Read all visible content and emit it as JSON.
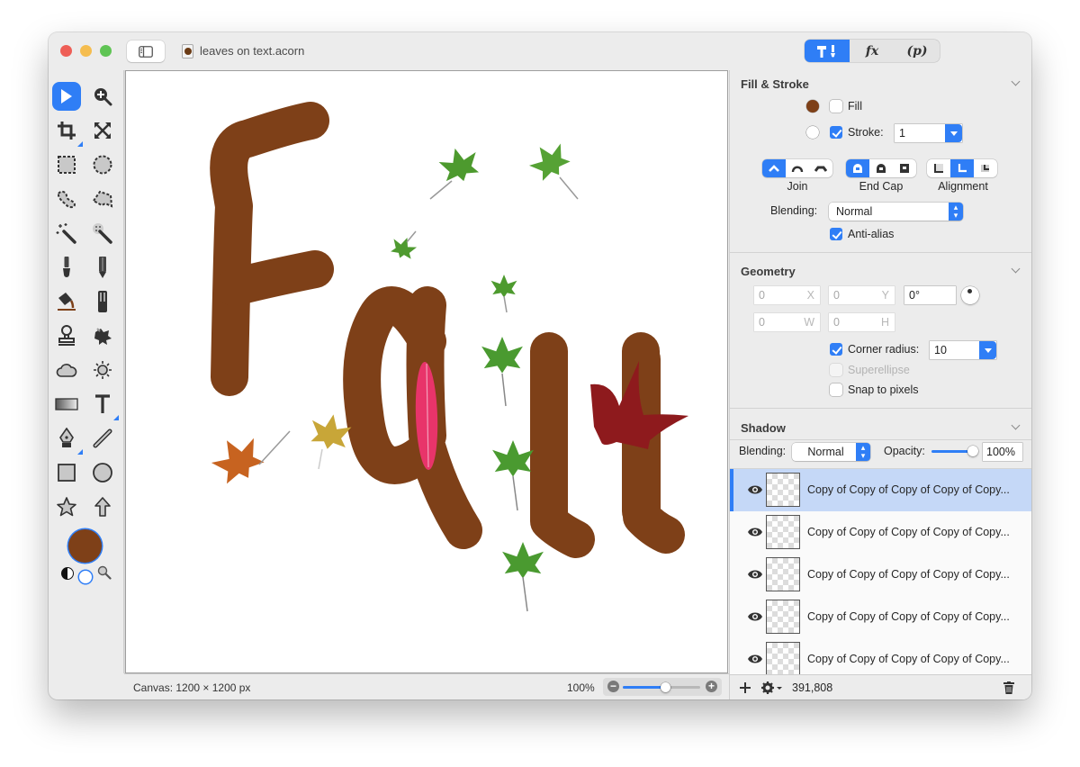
{
  "window": {
    "title": "leaves on text.acorn"
  },
  "inspector_tabs": [
    {
      "name": "tools",
      "label": "",
      "icon": "hammer-brush-icon",
      "active": true
    },
    {
      "name": "effects",
      "label": "fx",
      "active": false
    },
    {
      "name": "properties",
      "label": "(p)",
      "active": false
    }
  ],
  "toolbox": {
    "tools": [
      {
        "name": "select-tool",
        "icon": "arrow-pointer-icon",
        "active": true
      },
      {
        "name": "zoom-tool",
        "icon": "magnifier-plus-icon"
      },
      {
        "name": "crop-tool",
        "icon": "crop-icon"
      },
      {
        "name": "transform-tool",
        "icon": "expand-arrows-icon"
      },
      {
        "name": "rect-select-tool",
        "icon": "rect-marquee-icon"
      },
      {
        "name": "ellipse-select-tool",
        "icon": "ellipse-marquee-icon"
      },
      {
        "name": "lasso-tool",
        "icon": "lasso-icon"
      },
      {
        "name": "polygon-lasso-tool",
        "icon": "polygon-lasso-icon"
      },
      {
        "name": "magic-wand-tool",
        "icon": "magic-wand-icon"
      },
      {
        "name": "instant-alpha-tool",
        "icon": "instant-alpha-icon"
      },
      {
        "name": "brush-tool",
        "icon": "brush-icon"
      },
      {
        "name": "pencil-tool",
        "icon": "pencil-icon"
      },
      {
        "name": "paint-bucket-tool",
        "icon": "paint-bucket-icon"
      },
      {
        "name": "eraser-tool",
        "icon": "eraser-icon"
      },
      {
        "name": "clone-tool",
        "icon": "stamp-icon"
      },
      {
        "name": "smudge-tool",
        "icon": "splatter-icon"
      },
      {
        "name": "blur-tool",
        "icon": "cloud-icon"
      },
      {
        "name": "dodge-tool",
        "icon": "sun-icon"
      },
      {
        "name": "gradient-tool",
        "icon": "gradient-icon"
      },
      {
        "name": "text-tool",
        "icon": "text-t-icon"
      },
      {
        "name": "pen-tool",
        "icon": "pen-nib-icon"
      },
      {
        "name": "line-tool",
        "icon": "line-icon"
      },
      {
        "name": "rectangle-tool",
        "icon": "square-icon"
      },
      {
        "name": "oval-tool",
        "icon": "circle-icon"
      },
      {
        "name": "star-tool",
        "icon": "star-icon"
      },
      {
        "name": "arrow-tool",
        "icon": "up-arrow-icon"
      }
    ],
    "color_well": "#7e4018"
  },
  "canvas": {
    "text": "Fall",
    "text_color": "#7e4018"
  },
  "statusbar": {
    "canvas_size": "Canvas: 1200 × 1200 px",
    "zoom": "100%",
    "zoom_slider_fraction": 0.55
  },
  "fill_stroke": {
    "title": "Fill & Stroke",
    "fill_color": "#7e4018",
    "fill_label": "Fill",
    "fill_checked": false,
    "stroke_label": "Stroke:",
    "stroke_checked": true,
    "stroke_value": "1",
    "join_label": "Join",
    "endcap_label": "End Cap",
    "alignment_label": "Alignment",
    "blending_label": "Blending:",
    "blending_value": "Normal",
    "antialias_label": "Anti-alias",
    "antialias_checked": true
  },
  "geometry": {
    "title": "Geometry",
    "x": "0",
    "x_suffix": "X",
    "y": "0",
    "y_suffix": "Y",
    "angle": "0°",
    "w": "0",
    "w_suffix": "W",
    "h": "0",
    "h_suffix": "H",
    "corner_radius_label": "Corner radius:",
    "corner_radius_checked": true,
    "corner_radius_value": "10",
    "superellipse_label": "Superellipse",
    "snap_label": "Snap to pixels",
    "snap_checked": false
  },
  "shadow": {
    "title": "Shadow"
  },
  "layer_controls": {
    "blending_label": "Blending:",
    "blending_value": "Normal",
    "opacity_label": "Opacity:",
    "opacity_value": "100%"
  },
  "layers": [
    {
      "name": "Copy of Copy of Copy of Copy of Copy...",
      "visible": true,
      "selected": true
    },
    {
      "name": "Copy of Copy of Copy of Copy of Copy...",
      "visible": true,
      "selected": false
    },
    {
      "name": "Copy of Copy of Copy of Copy of Copy...",
      "visible": true,
      "selected": false
    },
    {
      "name": "Copy of Copy of Copy of Copy of Copy...",
      "visible": true,
      "selected": false
    },
    {
      "name": "Copy of Copy of Copy of Copy of Copy...",
      "visible": true,
      "selected": false
    }
  ],
  "layers_footer": {
    "count": "391,808"
  }
}
